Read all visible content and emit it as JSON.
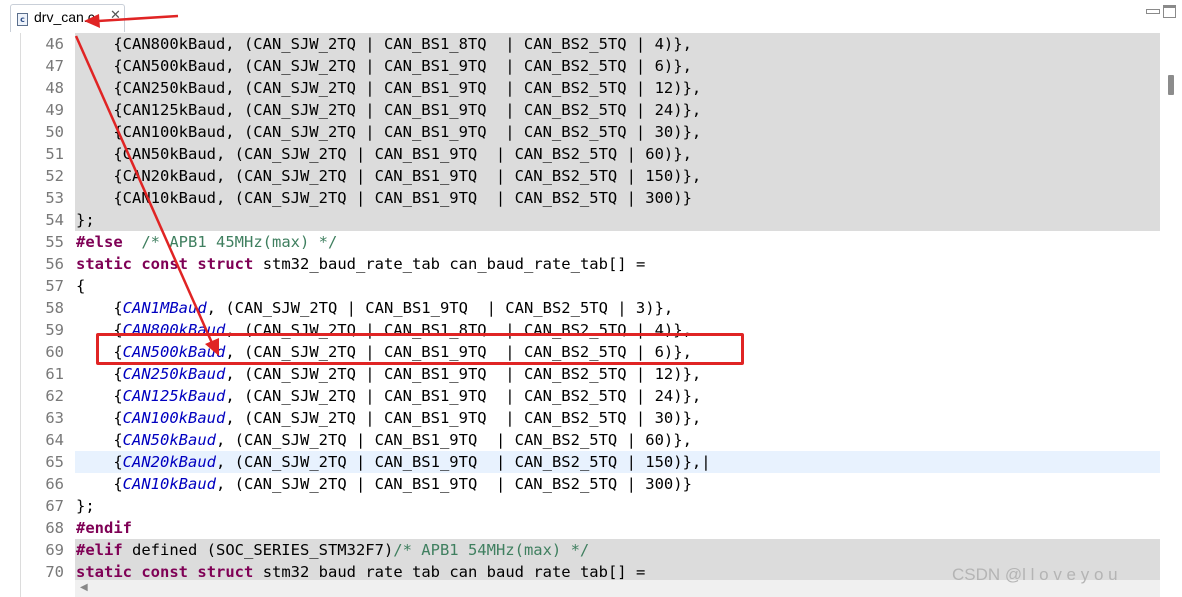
{
  "tab": {
    "icon": "c",
    "label": "drv_can.c",
    "close": "✕"
  },
  "window_controls": [
    "minimize-icon",
    "maximize-icon"
  ],
  "colors": {
    "shaded_line": "#dcdcdc",
    "current_line": "#e8f2fe",
    "highlight_box": "#e02424",
    "arrow": "#e02424"
  },
  "lines": [
    {
      "num": "46",
      "bg": "shade",
      "tokens": [
        {
          "t": "    {CAN800kBaud, (CAN_SJW_2TQ | CAN_BS1_8TQ  | CAN_BS2_5TQ | 4)},"
        }
      ]
    },
    {
      "num": "47",
      "bg": "shade",
      "tokens": [
        {
          "t": "    {CAN500kBaud, (CAN_SJW_2TQ | CAN_BS1_9TQ  | CAN_BS2_5TQ | 6)},"
        }
      ]
    },
    {
      "num": "48",
      "bg": "shade",
      "tokens": [
        {
          "t": "    {CAN250kBaud, (CAN_SJW_2TQ | CAN_BS1_9TQ  | CAN_BS2_5TQ | 12)},"
        }
      ]
    },
    {
      "num": "49",
      "bg": "shade",
      "tokens": [
        {
          "t": "    {CAN125kBaud, (CAN_SJW_2TQ | CAN_BS1_9TQ  | CAN_BS2_5TQ | 24)},"
        }
      ]
    },
    {
      "num": "50",
      "bg": "shade",
      "tokens": [
        {
          "t": "    {CAN100kBaud, (CAN_SJW_2TQ | CAN_BS1_9TQ  | CAN_BS2_5TQ | 30)},"
        }
      ]
    },
    {
      "num": "51",
      "bg": "shade",
      "tokens": [
        {
          "t": "    {CAN50kBaud, (CAN_SJW_2TQ | CAN_BS1_9TQ  | CAN_BS2_5TQ | 60)},"
        }
      ]
    },
    {
      "num": "52",
      "bg": "shade",
      "tokens": [
        {
          "t": "    {CAN20kBaud, (CAN_SJW_2TQ | CAN_BS1_9TQ  | CAN_BS2_5TQ | 150)},"
        }
      ]
    },
    {
      "num": "53",
      "bg": "shade",
      "tokens": [
        {
          "t": "    {CAN10kBaud, (CAN_SJW_2TQ | CAN_BS1_9TQ  | CAN_BS2_5TQ | 300)}"
        }
      ]
    },
    {
      "num": "54",
      "bg": "shade",
      "tokens": [
        {
          "t": "};"
        }
      ]
    },
    {
      "num": "55",
      "bg": "",
      "tokens": [
        {
          "t": "#else",
          "c": "kw"
        },
        {
          "t": "  "
        },
        {
          "t": "/* APB1 45MHz(max) */",
          "c": "cm"
        }
      ]
    },
    {
      "num": "56",
      "bg": "",
      "tokens": [
        {
          "t": "static",
          "c": "kw"
        },
        {
          "t": " "
        },
        {
          "t": "const",
          "c": "kw"
        },
        {
          "t": " "
        },
        {
          "t": "struct",
          "c": "kw"
        },
        {
          "t": " stm32_baud_rate_tab can_baud_rate_tab[] ="
        }
      ]
    },
    {
      "num": "57",
      "bg": "",
      "tokens": [
        {
          "t": "{"
        }
      ]
    },
    {
      "num": "58",
      "bg": "",
      "tokens": [
        {
          "t": "    {"
        },
        {
          "t": "CAN1MBaud",
          "c": "it"
        },
        {
          "t": ", (CAN_SJW_2TQ | CAN_BS1_9TQ  | CAN_BS2_5TQ | 3)},"
        }
      ]
    },
    {
      "num": "59",
      "bg": "",
      "tokens": [
        {
          "t": "    {"
        },
        {
          "t": "CAN800kBaud",
          "c": "it"
        },
        {
          "t": ", (CAN_SJW_2TQ | CAN_BS1_8TQ  | CAN_BS2_5TQ | 4)},"
        }
      ]
    },
    {
      "num": "60",
      "bg": "",
      "tokens": [
        {
          "t": "    {"
        },
        {
          "t": "CAN500kBaud",
          "c": "it"
        },
        {
          "t": ", (CAN_SJW_2TQ | CAN_BS1_9TQ  | CAN_BS2_5TQ | 6)},"
        }
      ]
    },
    {
      "num": "61",
      "bg": "",
      "tokens": [
        {
          "t": "    {"
        },
        {
          "t": "CAN250kBaud",
          "c": "it"
        },
        {
          "t": ", (CAN_SJW_2TQ | CAN_BS1_9TQ  | CAN_BS2_5TQ | 12)},"
        }
      ]
    },
    {
      "num": "62",
      "bg": "",
      "tokens": [
        {
          "t": "    {"
        },
        {
          "t": "CAN125kBaud",
          "c": "it"
        },
        {
          "t": ", (CAN_SJW_2TQ | CAN_BS1_9TQ  | CAN_BS2_5TQ | 24)},"
        }
      ]
    },
    {
      "num": "63",
      "bg": "",
      "tokens": [
        {
          "t": "    {"
        },
        {
          "t": "CAN100kBaud",
          "c": "it"
        },
        {
          "t": ", (CAN_SJW_2TQ | CAN_BS1_9TQ  | CAN_BS2_5TQ | 30)},"
        }
      ]
    },
    {
      "num": "64",
      "bg": "",
      "tokens": [
        {
          "t": "    {"
        },
        {
          "t": "CAN50kBaud",
          "c": "it"
        },
        {
          "t": ", (CAN_SJW_2TQ | CAN_BS1_9TQ  | CAN_BS2_5TQ | 60)},"
        }
      ]
    },
    {
      "num": "65",
      "bg": "current",
      "tokens": [
        {
          "t": "    {"
        },
        {
          "t": "CAN20kBaud",
          "c": "it"
        },
        {
          "t": ", (CAN_SJW_2TQ | CAN_BS1_9TQ  | CAN_BS2_5TQ | 150)},|"
        }
      ]
    },
    {
      "num": "66",
      "bg": "",
      "tokens": [
        {
          "t": "    {"
        },
        {
          "t": "CAN10kBaud",
          "c": "it"
        },
        {
          "t": ", (CAN_SJW_2TQ | CAN_BS1_9TQ  | CAN_BS2_5TQ | 300)}"
        }
      ]
    },
    {
      "num": "67",
      "bg": "",
      "tokens": [
        {
          "t": "};"
        }
      ]
    },
    {
      "num": "68",
      "bg": "",
      "tokens": [
        {
          "t": "#endif",
          "c": "kw"
        }
      ]
    },
    {
      "num": "69",
      "bg": "shade",
      "tokens": [
        {
          "t": "#elif",
          "c": "kw"
        },
        {
          "t": " defined (SOC_SERIES_STM32F7)"
        },
        {
          "t": "/* APB1 54MHz(max) */",
          "c": "cm"
        }
      ]
    },
    {
      "num": "70",
      "bg": "shade",
      "tokens": [
        {
          "t": "static",
          "c": "kw"
        },
        {
          "t": " "
        },
        {
          "t": "const",
          "c": "kw"
        },
        {
          "t": " "
        },
        {
          "t": "struct",
          "c": "kw"
        },
        {
          "t": " stm32_baud_rate_tab can_baud_rate_tab[] ="
        }
      ]
    }
  ],
  "watermark": "CSDN @l l o v e y o u"
}
